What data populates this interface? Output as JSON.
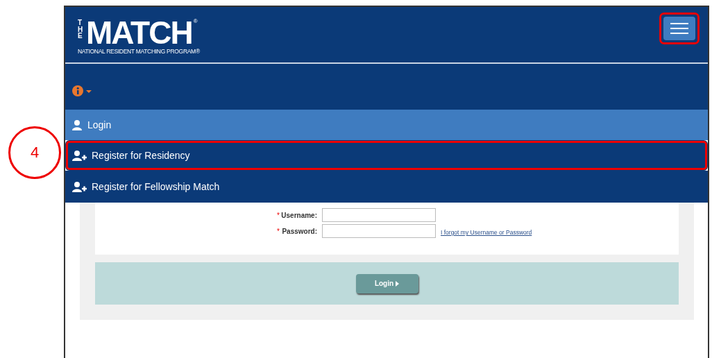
{
  "callout": {
    "label": "4"
  },
  "header": {
    "logo": {
      "vertical": "THE",
      "main": "MATCH",
      "mark": "®",
      "tagline": "NATIONAL RESIDENT MATCHING PROGRAM®"
    },
    "menu_button": {
      "highlighted": true
    }
  },
  "nav": [
    {
      "label": "Login",
      "kind": "login",
      "selected": true,
      "highlighted": false
    },
    {
      "label": "Register for Residency",
      "kind": "register",
      "selected": false,
      "highlighted": true
    },
    {
      "label": "Register for Fellowship Match",
      "kind": "register",
      "selected": false,
      "highlighted": false
    }
  ],
  "form": {
    "fields": [
      {
        "label": "Username:",
        "required_mark": "*"
      },
      {
        "label": "Password:",
        "required_mark": "*",
        "link": "I forgot my Username or Password"
      }
    ],
    "submit": "Login"
  }
}
